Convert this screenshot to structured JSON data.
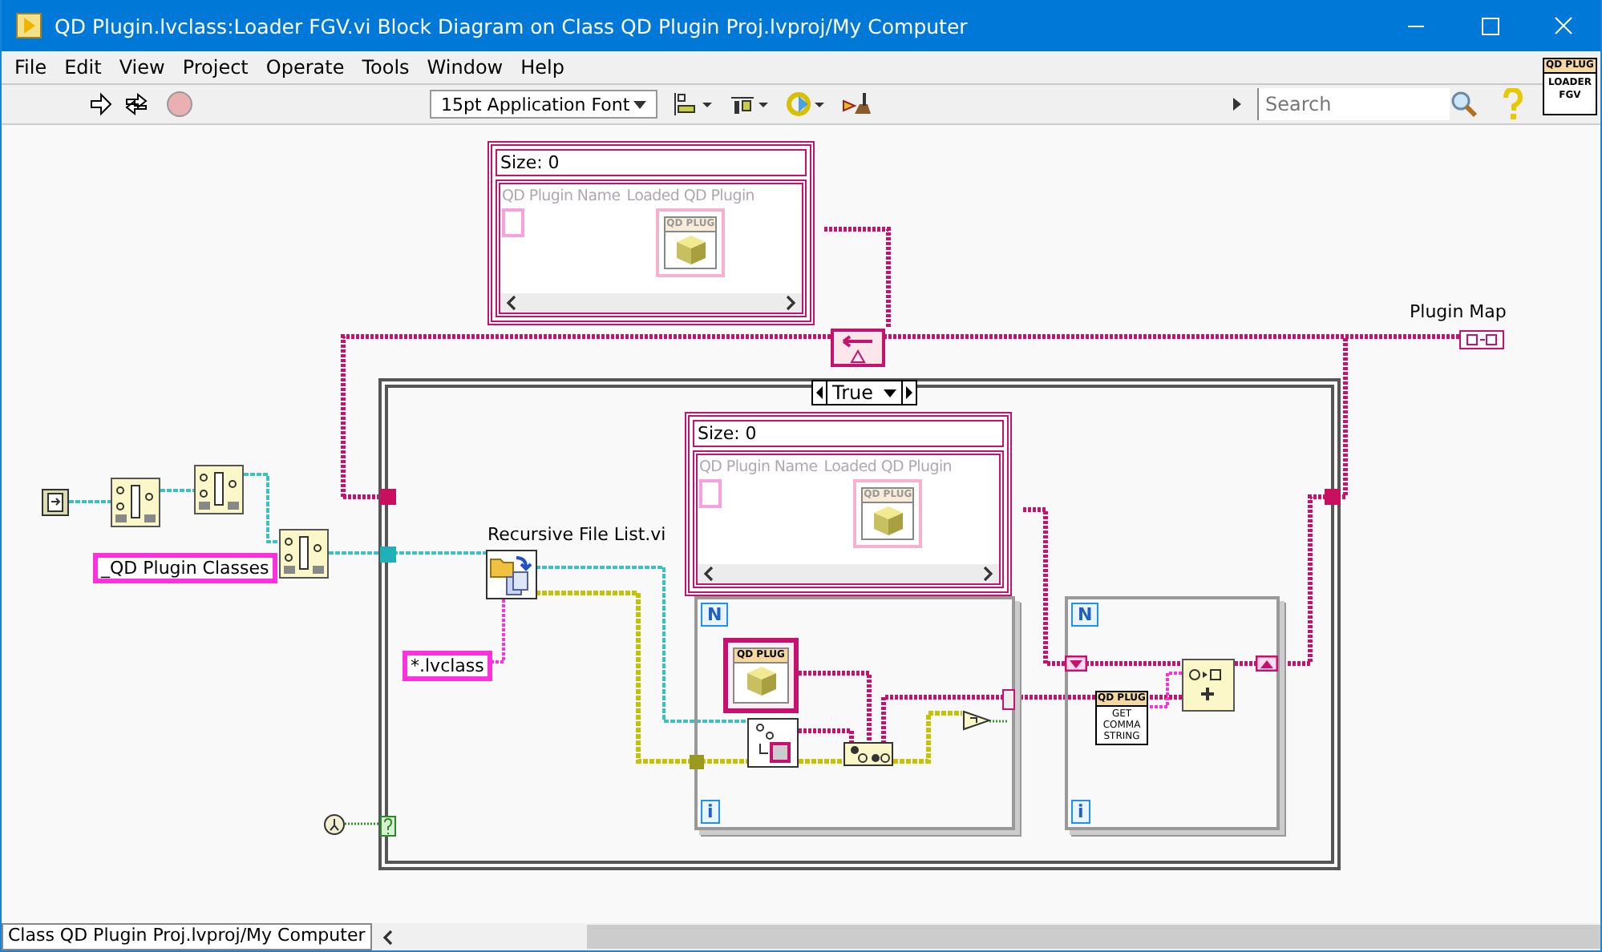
{
  "window": {
    "title": "QD Plugin.lvclass:Loader FGV.vi Block Diagram on Class QD Plugin Proj.lvproj/My Computer"
  },
  "menu": [
    "File",
    "Edit",
    "View",
    "Project",
    "Operate",
    "Tools",
    "Window",
    "Help"
  ],
  "toolbar": {
    "font": "15pt Application Font",
    "search": {
      "placeholder": "Search"
    },
    "vi_icon": {
      "top": "QD PLUG",
      "bottom": "LOADER FGV"
    }
  },
  "diagram": {
    "array_constants": [
      {
        "size_label": "Size: 0",
        "columns": [
          "QD Plugin Name",
          "Loaded QD Plugin"
        ],
        "class_label": "QD PLUG"
      },
      {
        "size_label": "Size: 0",
        "columns": [
          "QD Plugin Name",
          "Loaded QD Plugin"
        ],
        "class_label": "QD PLUG"
      }
    ],
    "map_indicator": {
      "label": "Plugin Map"
    },
    "case_structure": {
      "selector": "True"
    },
    "subvi": {
      "label": "Recursive File List.vi"
    },
    "string_constants": [
      "_QD Plugin Classes",
      "*.lvclass"
    ],
    "for_loops": [
      {
        "count": "N",
        "iteration": "i"
      },
      {
        "count": "N",
        "iteration": "i"
      }
    ],
    "class_constant": {
      "label": "QD PLUG"
    },
    "method_node": {
      "top": "QD PLUG",
      "bottom": "GET COMMA STRING"
    }
  },
  "status_bar": {
    "path": "Class QD Plugin Proj.lvproj/My Computer"
  }
}
